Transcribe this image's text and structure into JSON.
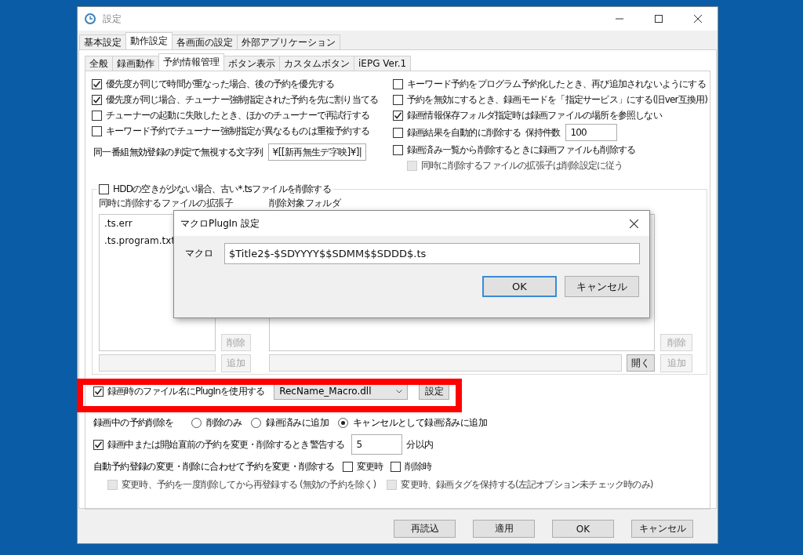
{
  "window": {
    "title": "設定"
  },
  "tabs": [
    {
      "label": "基本設定",
      "selected": false
    },
    {
      "label": "動作設定",
      "selected": true
    },
    {
      "label": "各画面の設定",
      "selected": false
    },
    {
      "label": "外部アプリケーション",
      "selected": false
    }
  ],
  "subtabs": [
    {
      "label": "全般",
      "selected": false
    },
    {
      "label": "録画動作",
      "selected": false
    },
    {
      "label": "予約情報管理",
      "selected": true
    },
    {
      "label": "ボタン表示",
      "selected": false
    },
    {
      "label": "カスタムボタン",
      "selected": false
    },
    {
      "label": "iEPG Ver.1",
      "selected": false
    }
  ],
  "left_options": [
    {
      "label": "優先度が同じで時間が重なった場合、後の予約を優先する",
      "checked": true
    },
    {
      "label": "優先度が同じ場合、チューナー強制指定された予約を先に割り当てる",
      "checked": true
    },
    {
      "label": "チューナーの起動に失敗したとき、ほかのチューナーで再試行する",
      "checked": false
    },
    {
      "label": "キーワード予約でチューナー強制指定が異なるものは重複予約する",
      "checked": false
    }
  ],
  "ignore_string": {
    "label": "同一番組無効登録の判定で無視する文字列",
    "value": "¥[[新再無生デ字映]¥]|"
  },
  "right_options": [
    {
      "kind": "check",
      "label": "キーワード予約をプログラム予約化したとき、再び追加されないようにする",
      "checked": false,
      "disabled": false
    },
    {
      "kind": "check",
      "label": "予約を無効にするとき、録画モードを「指定サービス」にする(旧ver互換用)",
      "checked": false,
      "disabled": false
    },
    {
      "kind": "check",
      "label": "録画情報保存フォルダ指定時は録画ファイルの場所を参照しない",
      "checked": true,
      "disabled": false
    },
    {
      "kind": "count",
      "label": "録画結果を自動的に削除する",
      "checked": false,
      "disabled": false,
      "count_label": "保持件数",
      "value": "100"
    },
    {
      "kind": "check",
      "label": "録画済み一覧から削除するときに録画ファイルも削除する",
      "checked": false,
      "disabled": false,
      "children": [
        {
          "kind": "check",
          "label": "同時に削除するファイルの拡張子は削除設定に従う",
          "checked": false,
          "disabled": true
        }
      ]
    }
  ],
  "hdd_group": {
    "label": "HDDの空きが少ない場合、古い*.tsファイルを削除する",
    "checked": false,
    "extensions": {
      "label": "同時に削除するファイルの拡張子",
      "items": [
        ".ts.err",
        ".ts.program.txt"
      ],
      "buttons": [
        {
          "label": "削除",
          "disabled": true
        },
        {
          "label": "追加",
          "disabled": true
        }
      ]
    },
    "folders": {
      "label": "削除対象フォルダ",
      "open_button": {
        "label": "開く",
        "disabled": false
      },
      "buttons": [
        {
          "label": "削除",
          "disabled": true
        },
        {
          "label": "追加",
          "disabled": true
        }
      ]
    }
  },
  "plugin": {
    "label": "録画時のファイル名にPlugInを使用する",
    "checked": true,
    "value": "RecName_Macro.dll",
    "settings_button": "設定",
    "highlighted": true
  },
  "recording_delete": {
    "label": "録画中の予約削除を",
    "options": [
      {
        "label": "削除のみ",
        "selected": false
      },
      {
        "label": "録画済みに追加",
        "selected": false
      },
      {
        "label": "キャンセルとして録画済みに追加",
        "selected": true
      }
    ]
  },
  "warn": {
    "label": "録画中または開始直前の予約を変更・削除するとき警告する",
    "checked": true,
    "value": "5",
    "unit": "分以内"
  },
  "auto_sync": {
    "label": "自動予約登録の変更・削除に合わせて予約を変更・削除する",
    "options": [
      {
        "label": "変更時",
        "checked": false
      },
      {
        "label": "削除時",
        "checked": false
      }
    ],
    "sub_options": [
      {
        "label": "変更時、予約を一度削除してから再登録する (無効の予約を除く)",
        "checked": false,
        "disabled": true
      },
      {
        "label": "変更時、録画タグを保持する(左記オプション未チェック時のみ)",
        "checked": false,
        "disabled": true
      }
    ]
  },
  "footer_buttons": [
    "再読込",
    "適用",
    "OK",
    "キャンセル"
  ],
  "dialog": {
    "title": "マクロPlugIn 設定",
    "field_label": "マクロ",
    "value": "$Title2$-$SDYYYY$$SDMM$$SDDD$.ts",
    "buttons": [
      {
        "label": "OK",
        "default": true
      },
      {
        "label": "キャンセル",
        "default": false
      }
    ]
  }
}
